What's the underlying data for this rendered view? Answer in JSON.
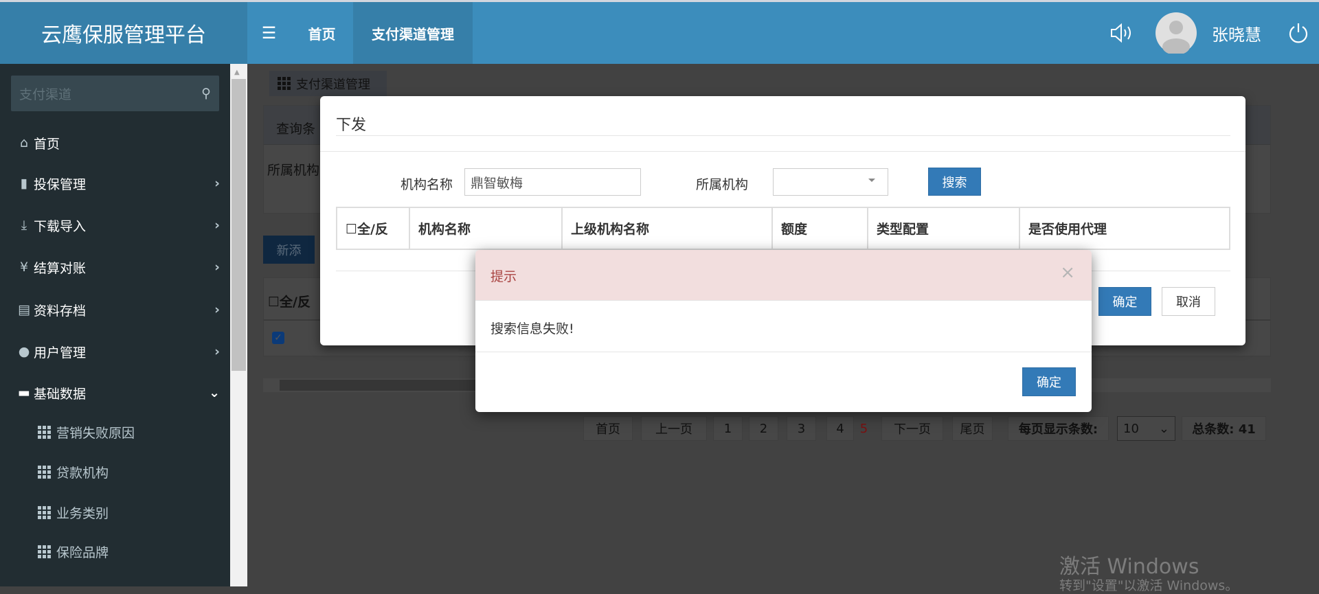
{
  "app": {
    "title": "云鹰保服管理平台"
  },
  "navbar": {
    "menu_icon": "hamburger-icon",
    "items": [
      {
        "label": "首页"
      },
      {
        "label": "支付渠道管理",
        "active": true
      }
    ],
    "user": {
      "name": "张晓慧"
    },
    "icons": [
      "speaker-icon",
      "avatar",
      "power-icon"
    ]
  },
  "sidebar": {
    "search_placeholder": "支付渠道",
    "items": [
      {
        "label": "首页",
        "icon": "home-icon"
      },
      {
        "label": "投保管理",
        "icon": "file-icon",
        "expandable": true
      },
      {
        "label": "下载导入",
        "icon": "import-icon",
        "expandable": true
      },
      {
        "label": "结算对账",
        "icon": "yen-icon",
        "expandable": true
      },
      {
        "label": "资料存档",
        "icon": "list-icon",
        "expandable": true
      },
      {
        "label": "用户管理",
        "icon": "user-icon",
        "expandable": true
      },
      {
        "label": "基础数据",
        "icon": "hdd-icon",
        "expanded": true
      }
    ],
    "subitems": [
      {
        "label": "营销失败原因"
      },
      {
        "label": "贷款机构"
      },
      {
        "label": "业务类别"
      },
      {
        "label": "保险品牌"
      }
    ]
  },
  "page": {
    "breadcrumb": "支付渠道管理",
    "query_title": "查询条",
    "query_label": "所属机构",
    "add_button": "新添",
    "table_header_check": "全/反",
    "row_checked": true,
    "pagination": {
      "first": "首页",
      "prev": "上一页",
      "pages": [
        "1",
        "2",
        "3",
        "4",
        "5"
      ],
      "current": "5",
      "next": "下一页",
      "last": "尾页",
      "page_size_label": "每页显示条数:",
      "page_size": "10",
      "total": "总条数: 41"
    }
  },
  "modal": {
    "title": "下发",
    "org_name_label": "机构名称",
    "org_name_value": "鼎智敏梅",
    "parent_org_label": "所属机构",
    "parent_org_value": "",
    "search_button": "搜索",
    "columns": [
      "全/反",
      "机构名称",
      "上级机构名称",
      "额度",
      "类型配置",
      "是否使用代理"
    ],
    "confirm_button": "确定",
    "cancel_button": "取消"
  },
  "alert": {
    "title": "提示",
    "message": "搜索信息失败!",
    "ok_button": "确定",
    "header_color": "#f2dede",
    "title_color": "#a94442"
  },
  "watermark": {
    "line1": "激活 Windows",
    "line2": "转到\"设置\"以激活 Windows。"
  }
}
